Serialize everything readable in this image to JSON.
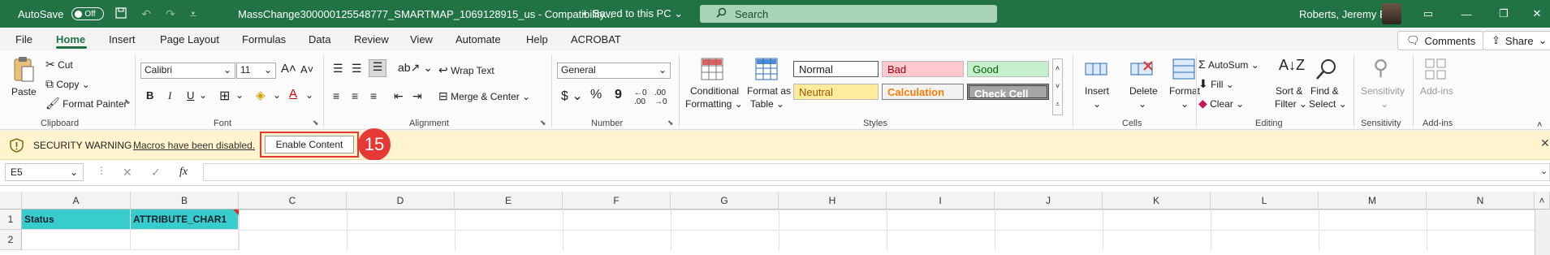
{
  "titlebar": {
    "autosave_label": "AutoSave",
    "autosave_state": "Off",
    "doc_title": "MassChange300000125548777_SMARTMAP_1069128915_us  -  Compatibility...",
    "saved_status": "Saved to this PC",
    "search_placeholder": "Search",
    "user_name": "Roberts, Jeremy B",
    "accent_color": "#217346"
  },
  "menu": {
    "items": [
      "File",
      "Home",
      "Insert",
      "Page Layout",
      "Formulas",
      "Data",
      "Review",
      "View",
      "Automate",
      "Help",
      "ACROBAT"
    ],
    "comments_label": "Comments",
    "share_label": "Share"
  },
  "ribbon": {
    "clipboard": {
      "paste": "Paste",
      "cut": "Cut",
      "copy": "Copy",
      "format_painter": "Format Painter",
      "label": "Clipboard"
    },
    "font": {
      "name": "Calibri",
      "size": "11",
      "label": "Font",
      "bold": "B",
      "italic": "I",
      "underline": "U"
    },
    "alignment": {
      "wrap_text": "Wrap Text",
      "merge_center": "Merge & Center",
      "label": "Alignment"
    },
    "number": {
      "format": "General",
      "currency": "$",
      "percent": "%",
      "comma": "9",
      "label": "Number"
    },
    "styles": {
      "conditional": "Conditional",
      "formatting": "Formatting",
      "format_as": "Format as",
      "table": "Table",
      "cells": [
        "Normal",
        "Bad",
        "Good",
        "Neutral",
        "Calculation",
        "Check Cell"
      ],
      "label": "Styles"
    },
    "cells_group": {
      "insert": "Insert",
      "delete": "Delete",
      "format": "Format",
      "label": "Cells"
    },
    "editing": {
      "autosum": "AutoSum",
      "fill": "Fill",
      "clear": "Clear",
      "sort": "Sort &",
      "filter": "Filter",
      "find": "Find &",
      "select": "Select",
      "label": "Editing"
    },
    "sensitivity": {
      "btn": "Sensitivity",
      "label": "Sensitivity"
    },
    "addins": {
      "btn": "Add-ins",
      "label": "Add-ins"
    }
  },
  "security": {
    "title": "SECURITY WARNING",
    "message": "Macros have been disabled.",
    "button": "Enable Content",
    "step_badge": "15"
  },
  "formula_bar": {
    "name_box": "E5",
    "fx": "fx",
    "value": ""
  },
  "sheet": {
    "columns": [
      "A",
      "B",
      "C",
      "D",
      "E",
      "F",
      "G",
      "H",
      "I",
      "J",
      "K",
      "L",
      "M",
      "N"
    ],
    "rows": [
      "1",
      "2"
    ],
    "cells": {
      "A1": "Status",
      "B1": "ATTRIBUTE_CHAR1"
    }
  }
}
